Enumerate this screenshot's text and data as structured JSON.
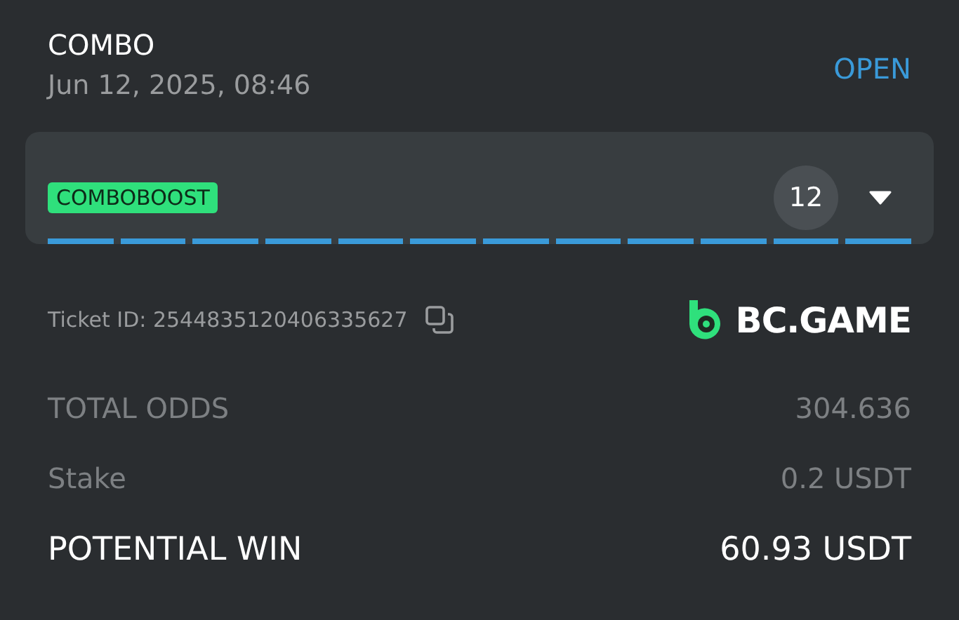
{
  "bet": {
    "type": "COMBO",
    "date": "Jun 12, 2025, 08:46",
    "status": "OPEN"
  },
  "boost": {
    "badge": "COMBOBOOST",
    "count": "12",
    "expanded": false,
    "legs": [
      {
        "settled": false
      },
      {
        "settled": false
      },
      {
        "settled": false
      },
      {
        "settled": false
      },
      {
        "settled": false
      },
      {
        "settled": false
      },
      {
        "settled": false
      },
      {
        "settled": false
      },
      {
        "settled": false
      },
      {
        "settled": false
      },
      {
        "settled": false
      },
      {
        "settled": false
      }
    ]
  },
  "ticket": {
    "label": "Ticket ID: 2544835120406335627",
    "brand": "BC.GAME"
  },
  "summary": [
    {
      "kind": "muted",
      "label": "TOTAL ODDS",
      "value": "304.636"
    },
    {
      "kind": "muted",
      "label": "Stake",
      "value": "0.2 USDT"
    },
    {
      "kind": "strong",
      "label": "POTENTIAL WIN",
      "value": "60.93 USDT"
    }
  ]
}
